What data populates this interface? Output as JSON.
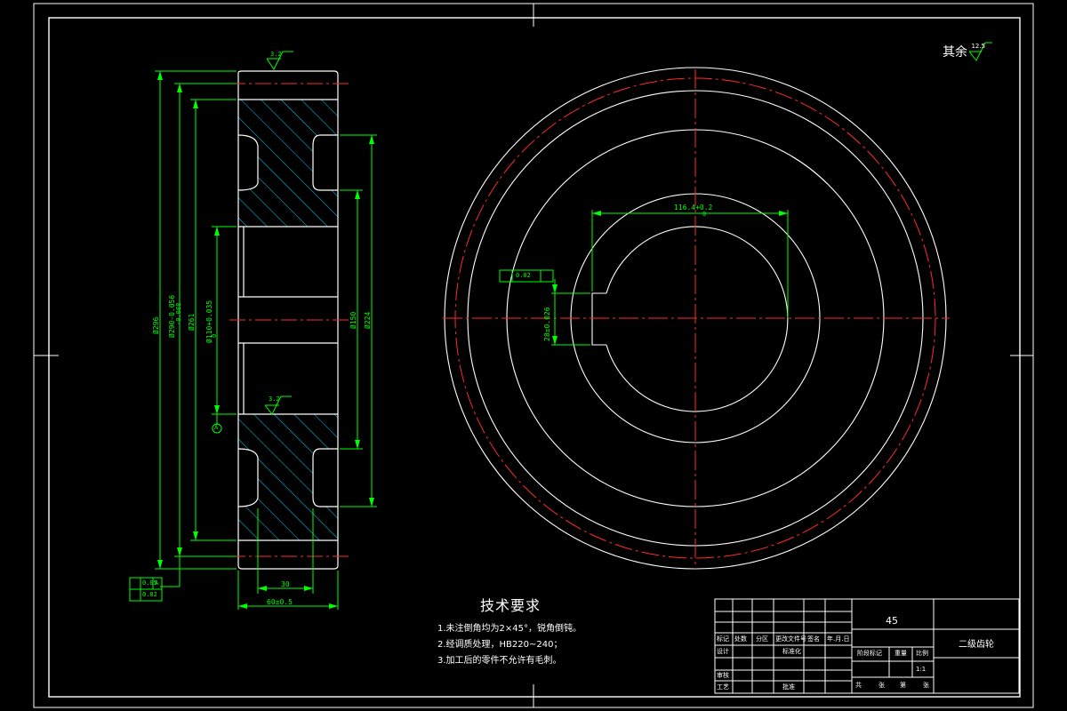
{
  "title_block": {
    "material": "45",
    "part_name": "二级齿轮",
    "scale": "1:1",
    "h_mark": "标记",
    "h_count": "处数",
    "h_zone": "分区",
    "h_change": "更改文件号",
    "h_sign": "签名",
    "h_date": "年.月.日",
    "r_design": "设计",
    "r_std": "标准化",
    "r_review": "审核",
    "r_process": "工艺",
    "r_approve": "批准",
    "stage_mark": "阶段标记",
    "weight": "重量",
    "scale_label": "比例",
    "sheets_total": "共",
    "sheets_zhang": "张",
    "sheets_di": "第",
    "sheets_zhang2": "张"
  },
  "tech_requirements": {
    "title": "技术要求",
    "items": [
      "1.未注倒角均为2×45°，锐角倒钝。",
      "2.经调质处理，HB220~240；",
      "3.加工后的零件不允许有毛刺。"
    ]
  },
  "roughness_note": {
    "label": "其余",
    "value": "12.5"
  },
  "dimensions": {
    "d296": "Ø296",
    "d290": "Ø290-0.056",
    "d290_lower": "-0.088",
    "d261": "Ø261",
    "d110": "Ø110+0.035",
    "d110_lower": "0",
    "d150": "Ø150",
    "d224": "Ø224",
    "w30": "30",
    "w60": "60±0.5",
    "keyway": "116.4+0.2",
    "keyway_lower": "0",
    "key_width": "28±0.026",
    "rough_top": "3.2",
    "rough_mid": "3.2",
    "datum_a": "A",
    "tol_runout": "0.05",
    "tol_perp": "0.02",
    "tol_sym": "0.02",
    "tol_ref": "A"
  }
}
